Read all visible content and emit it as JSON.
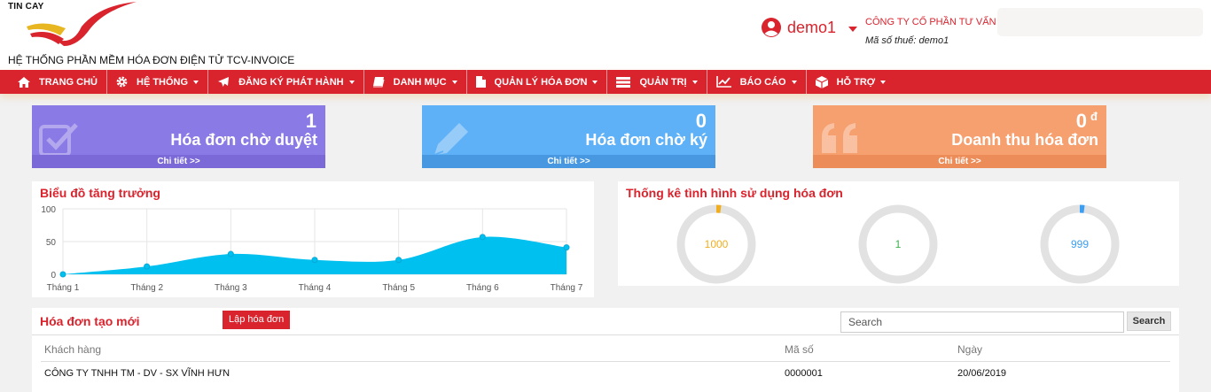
{
  "header": {
    "logo_text": "TIN CAY",
    "app_title": "HỆ THỐNG PHẦN MỀM HÓA ĐƠN ĐIỆN TỬ TCV-INVOICE",
    "user_name": "demo1",
    "company": "CÔNG TY CỔ PHẦN TƯ VẤN",
    "tax_label": "Mã số thuế:",
    "tax_id": "demo1"
  },
  "nav": [
    {
      "label": "TRANG CHỦ",
      "icon": "home-icon",
      "dropdown": false
    },
    {
      "label": "HỆ THỐNG",
      "icon": "gear-icon",
      "dropdown": true
    },
    {
      "label": "ĐĂNG KÝ PHÁT HÀNH",
      "icon": "plane-icon",
      "dropdown": true
    },
    {
      "label": "DANH MỤC",
      "icon": "book-icon",
      "dropdown": true
    },
    {
      "label": "QUẢN LÝ HÓA ĐƠN",
      "icon": "file-icon",
      "dropdown": true
    },
    {
      "label": "QUẢN TRỊ",
      "icon": "server-icon",
      "dropdown": true
    },
    {
      "label": "BÁO CÁO",
      "icon": "line-chart-icon",
      "dropdown": true
    },
    {
      "label": "HỖ TRỢ",
      "icon": "cube-icon",
      "dropdown": true
    }
  ],
  "cards": {
    "pending_approval": {
      "count": "1",
      "label": "Hóa đơn chờ duyệt",
      "detail": "Chi tiết >>"
    },
    "pending_sign": {
      "count": "0",
      "label": "Hóa đơn chờ ký",
      "detail": "Chi tiết >>"
    },
    "revenue": {
      "count": "0",
      "currency": "đ",
      "label": "Doanh thu hóa đơn",
      "detail": "Chi tiết >>"
    }
  },
  "growth_chart": {
    "title": "Biểu đồ tăng trưởng"
  },
  "chart_data": {
    "type": "area",
    "x": [
      "Tháng 1",
      "Tháng 2",
      "Tháng 3",
      "Tháng 4",
      "Tháng 5",
      "Tháng 6",
      "Tháng 7"
    ],
    "values": [
      0,
      12,
      31,
      22,
      22,
      57,
      41
    ],
    "yticks": [
      0,
      50,
      100
    ],
    "ylim": [
      0,
      100
    ],
    "color": "#00c0ef",
    "grid": true
  },
  "usage": {
    "title": "Thống kê tình hình sử dụng hóa đơn",
    "donuts": [
      {
        "value": "1000",
        "fraction": 0.02,
        "color": "#f0ad1e"
      },
      {
        "value": "1",
        "fraction": 0.0,
        "color": "#3cb04d"
      },
      {
        "value": "999",
        "fraction": 0.02,
        "color": "#3a9ef2"
      }
    ]
  },
  "invoices": {
    "title": "Hóa đơn tạo mới",
    "create_button": "Lập hóa đơn",
    "search_placeholder": "Search",
    "search_button": "Search",
    "columns": [
      "Khách hàng",
      "Mã số",
      "Ngày"
    ],
    "rows": [
      [
        "CÔNG TY TNHH TM - DV - SX VĨNH HƯN",
        "0000001",
        "20/06/2019"
      ]
    ]
  },
  "colors": {
    "brand_red": "#d9232d",
    "card_purple": "#8a7ae6",
    "card_blue": "#5fb1f7",
    "card_orange": "#f6a070"
  }
}
